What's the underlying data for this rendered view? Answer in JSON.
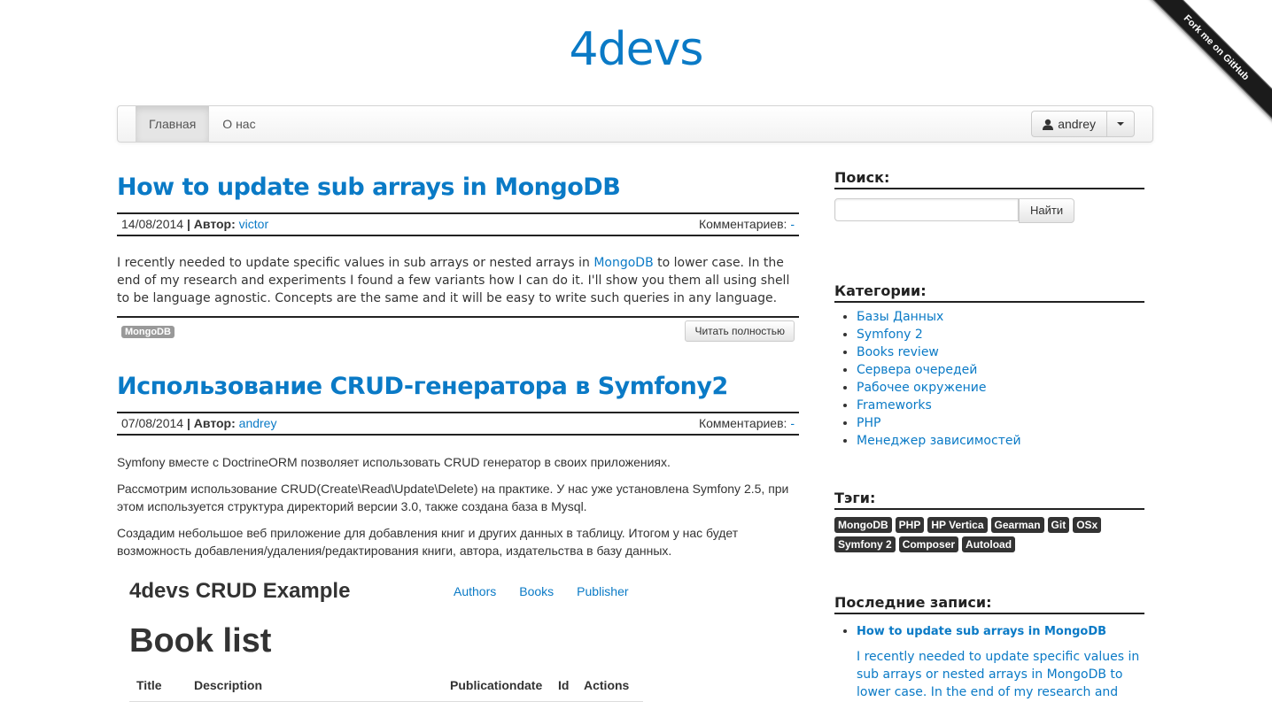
{
  "site": {
    "title": "4devs",
    "ribbon": "Fork me on GitHub"
  },
  "navbar": {
    "items": [
      {
        "label": "Главная",
        "active": true
      },
      {
        "label": "О нас",
        "active": false
      }
    ],
    "user": "andrey"
  },
  "posts": [
    {
      "title": "How to update sub arrays in MongoDB",
      "date": "14/08/2014",
      "author_label": "Автор:",
      "author": "victor",
      "comments_label": "Комментариев:",
      "comments": "-",
      "excerpt_before": "I recently needed to update specific values in sub arrays or nested arrays in ",
      "excerpt_link": "MongoDB",
      "excerpt_after": " to lower case. In the end of my research and experiments I found a few variants how I can do it. I'll show you them all using shell to be language agnostic. Concepts are the same and it will be easy to write such queries in any language.",
      "tag": "MongoDB",
      "read_more": "Читать полностью"
    },
    {
      "title": "Использование CRUD-генератора в Symfony2",
      "date": "07/08/2014",
      "author_label": "Автор:",
      "author": "andrey",
      "comments_label": "Комментариев:",
      "comments": "-",
      "paragraphs": [
        "Symfony вместе с DoctrineORM позволяет использовать CRUD генератор в своих приложениях.",
        "Рассмотрим использование CRUD(Create\\Read\\Update\\Delete) на практике. У нас уже установлена Symfony 2.5, при этом используется структура директорий версии 3.0, также создана база в Mysql.",
        "Создадим небольшое веб приложение для добавления книг и других данных в таблицу. Итогом у нас будет возможность добавления/удаления/редактирования книги, автора, издательства в базу данных."
      ],
      "embed": {
        "brand": "4devs CRUD Example",
        "links": [
          "Authors",
          "Books",
          "Publisher"
        ],
        "heading": "Book list",
        "columns": [
          "Title",
          "Description",
          "Publicationdate",
          "Id",
          "Actions"
        ]
      }
    }
  ],
  "sidebar": {
    "search": {
      "title": "Поиск:",
      "button": "Найти",
      "value": ""
    },
    "categories": {
      "title": "Категории:",
      "items": [
        "Базы Данных",
        "Symfony 2",
        "Books review",
        "Сервера очередей",
        "Рабочее окружение",
        "Frameworks",
        "PHP",
        "Менеджер зависимостей"
      ]
    },
    "tags": {
      "title": "Тэги:",
      "items": [
        "MongoDB",
        "PHP",
        "HP Vertica",
        "Gearman",
        "Git",
        "OSx",
        "Symfony 2",
        "Composer",
        "Autoload"
      ]
    },
    "recent": {
      "title": "Последние записи:",
      "item_title": "How to update sub arrays in MongoDB",
      "item_excerpt": "I recently needed to update specific values in sub arrays or nested arrays in MongoDB to lower case. In the end of my research and"
    }
  },
  "colors": {
    "link": "#0a7ac6",
    "tag_bg": "#333333",
    "label_gray": "#999999"
  }
}
